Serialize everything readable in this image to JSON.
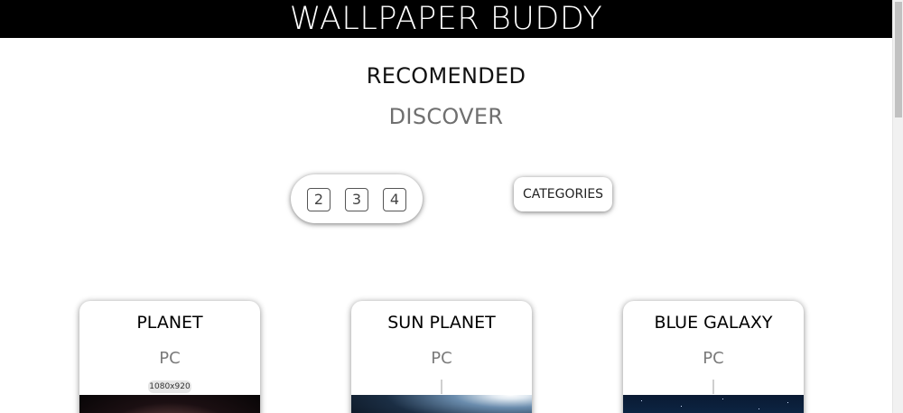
{
  "header": {
    "title": "WALLPAPER BUDDY"
  },
  "nav": {
    "recommended": "RECOMENDED",
    "discover": "DISCOVER"
  },
  "pagination": {
    "pages": [
      "2",
      "3",
      "4"
    ]
  },
  "categories_label": "CATEGORIES",
  "cards": [
    {
      "title": "PLANET",
      "platform": "PC",
      "resolution": "1080x920",
      "image": "planet-thumbnail"
    },
    {
      "title": "SUN PLANET",
      "platform": "PC",
      "image": "sun-planet-thumbnail"
    },
    {
      "title": "BLUE GALAXY",
      "platform": "PC",
      "image": "blue-galaxy-thumbnail"
    }
  ],
  "colors": {
    "header_bg": "#000000",
    "header_text": "#ffffff",
    "discover_text": "#6f6f6f"
  }
}
